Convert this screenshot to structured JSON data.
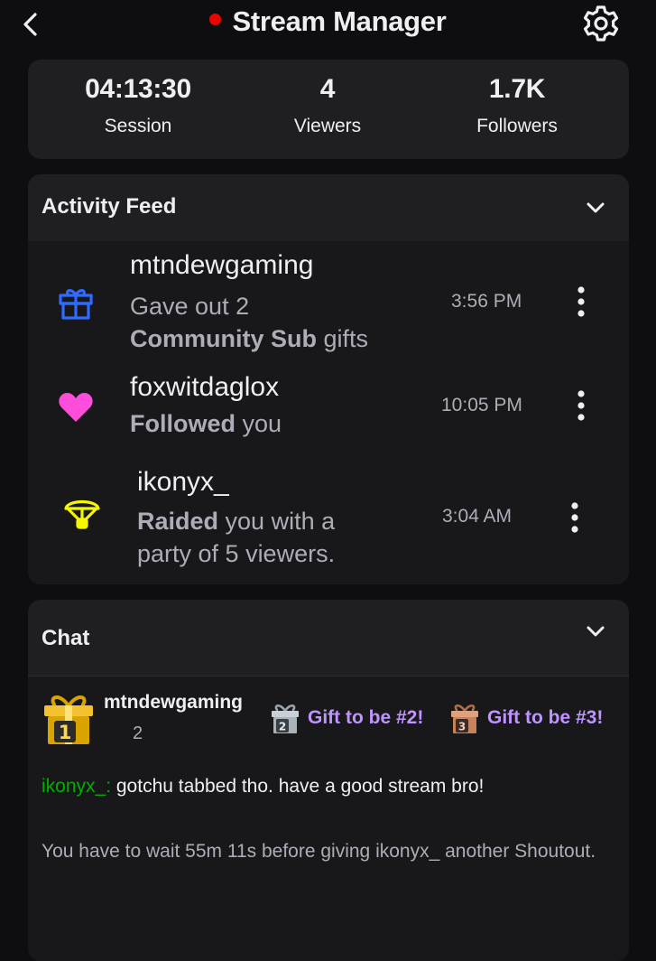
{
  "header": {
    "title": "Stream Manager",
    "back_icon": "chevron-left-icon",
    "settings_icon": "gear-icon",
    "live_color": "#eb0400"
  },
  "stats": [
    {
      "value": "04:13:30",
      "label": "Session"
    },
    {
      "value": "4",
      "label": "Viewers"
    },
    {
      "value": "1.7K",
      "label": "Followers"
    }
  ],
  "activity_feed": {
    "title": "Activity Feed",
    "items": [
      {
        "icon": "gift-icon",
        "icon_color": "#2e6cff",
        "user": "mtndewgaming",
        "desc_line1": "Gave out 2",
        "desc_bold": "Community Sub",
        "desc_rest": " gifts",
        "time": "3:56 PM"
      },
      {
        "icon": "heart-icon",
        "icon_color": "#ff4ddb",
        "user": "foxwitdaglox",
        "desc_bold": "Followed",
        "desc_rest": " you",
        "time": "10:05 PM"
      },
      {
        "icon": "parachute-icon",
        "icon_color": "#f6f600",
        "user": "ikonyx_",
        "desc_bold": "Raided",
        "desc_rest": " you with a",
        "desc_line2": "party of 5 viewers.",
        "time": "3:04 AM"
      }
    ]
  },
  "chat": {
    "title": "Chat",
    "leaderboard": {
      "first_name": "mtndewgaming",
      "first_count": "2",
      "slot2_number": "2",
      "slot2_label": "Gift to be #2!",
      "slot3_number": "3",
      "slot3_label": "Gift to be #3!"
    },
    "messages": [
      {
        "user": "ikonyx_:",
        "text": " gotchu tabbed tho. have a good stream bro!"
      }
    ],
    "notice": "You have to wait 55m 11s before giving ikonyx_ another Shoutout."
  },
  "colors": {
    "background": "#0e0e10",
    "card": "#1f1f23",
    "accent_purple": "#bf94ff",
    "chat_user_green": "#00ad03"
  }
}
